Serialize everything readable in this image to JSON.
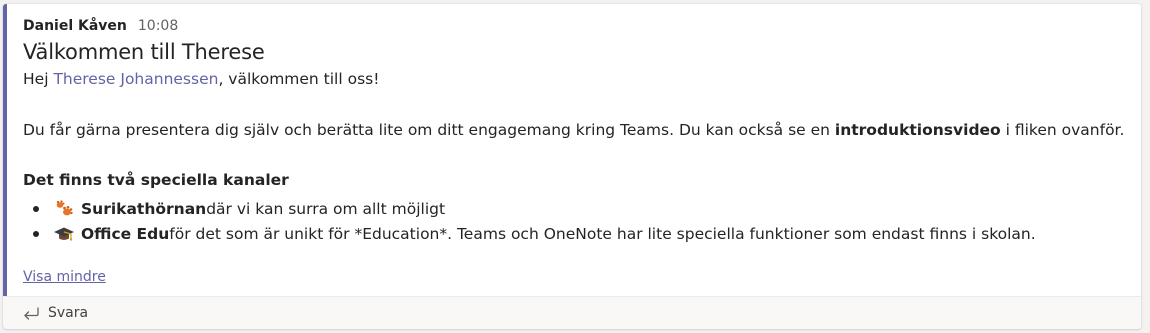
{
  "colors": {
    "accent": "#6264a7",
    "mention": "#6264a7",
    "text": "#252423",
    "muted": "#616161",
    "card_bg": "#ffffff",
    "reply_bg": "#f9f8f7"
  },
  "message": {
    "author": "Daniel Kåven",
    "time": "10:08",
    "subject": "Välkommen till Therese",
    "greeting": {
      "prefix": "Hej ",
      "mention": "Therese Johannessen",
      "suffix": ", välkommen till oss!"
    },
    "intro": {
      "before": "Du får gärna presentera dig själv och berätta lite om ditt engagemang kring Teams. Du kan också se en ",
      "bold": "introduktionsvideo",
      "after": " i fliken ovanför."
    },
    "channels_heading": "Det finns två speciella kanaler",
    "channels": [
      {
        "icon": "meerkat-paw-emoji-icon",
        "name": "Surikathörnan",
        "description": " där vi kan surra om allt möjligt"
      },
      {
        "icon": "graduation-cap-emoji-icon",
        "name": "Office Edu",
        "description": " för det som är unikt för *Education*. Teams och OneNote har lite speciella funktioner som endast finns i skolan."
      }
    ],
    "show_less": "Visa mindre"
  },
  "reply": {
    "icon": "reply-arrow-icon",
    "label": "Svara"
  }
}
